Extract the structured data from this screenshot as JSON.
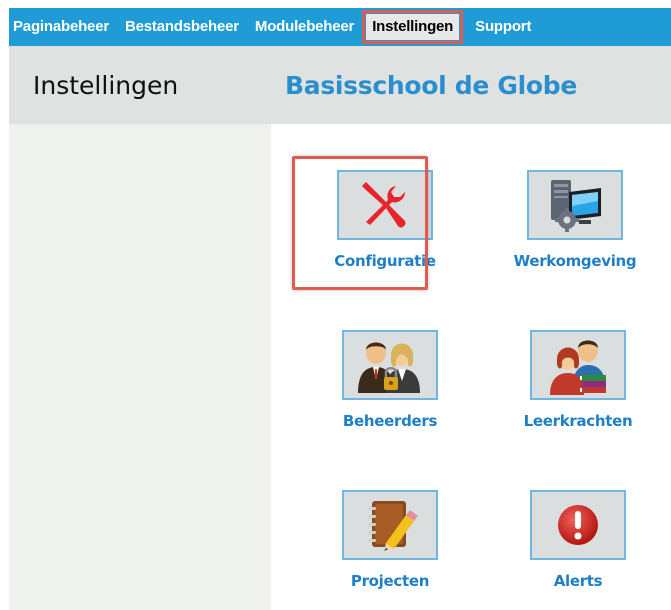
{
  "nav": {
    "items": [
      {
        "label": "Paginabeheer",
        "active": false
      },
      {
        "label": "Bestandsbeheer",
        "active": false
      },
      {
        "label": "Modulebeheer",
        "active": false
      },
      {
        "label": "Instellingen",
        "active": true
      },
      {
        "label": "Support",
        "active": false
      }
    ]
  },
  "header": {
    "title": "Instellingen",
    "school": "Basisschool de Globe"
  },
  "tiles": [
    {
      "label": "Configuratie",
      "icon": "tools-icon"
    },
    {
      "label": "Werkomgeving",
      "icon": "computer-gear-icon"
    },
    {
      "label": "Beheerders",
      "icon": "admins-icon"
    },
    {
      "label": "Leerkrachten",
      "icon": "teachers-icon"
    },
    {
      "label": "Projecten",
      "icon": "notebook-pencil-icon"
    },
    {
      "label": "Alerts",
      "icon": "alert-icon"
    }
  ],
  "colors": {
    "nav_bg": "#1f9bd6",
    "accent_blue": "#2a8fd0",
    "highlight_red": "#e05a4e"
  }
}
